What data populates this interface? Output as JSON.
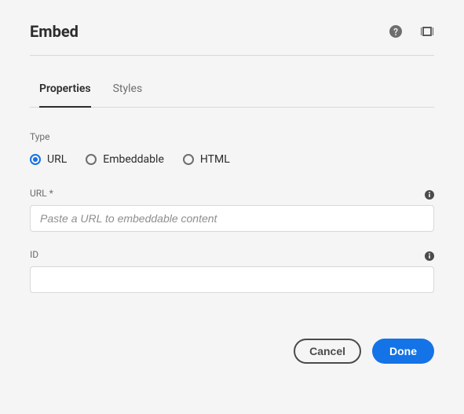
{
  "header": {
    "title": "Embed"
  },
  "tabs": {
    "properties": "Properties",
    "styles": "Styles"
  },
  "type": {
    "label": "Type",
    "options": {
      "url": "URL",
      "embeddable": "Embeddable",
      "html": "HTML"
    },
    "selected": "url"
  },
  "fields": {
    "url": {
      "label": "URL *",
      "placeholder": "Paste a URL to embeddable content",
      "value": ""
    },
    "id": {
      "label": "ID",
      "value": ""
    }
  },
  "footer": {
    "cancel": "Cancel",
    "done": "Done"
  }
}
